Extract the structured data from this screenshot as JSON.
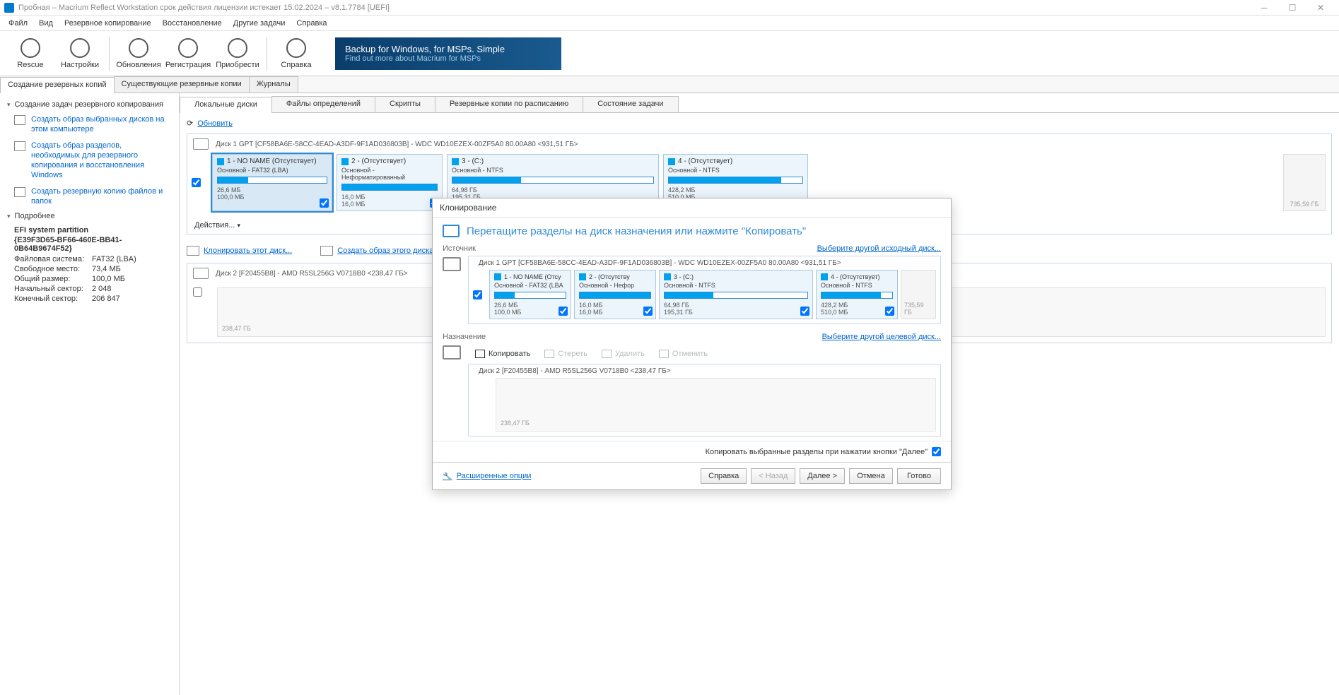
{
  "titlebar": {
    "title": "Пробная – Macrium Reflect Workstation срок действия лицензии истекает 15.02.2024 – v8.1.7784  [UEFI]"
  },
  "menu": [
    "Файл",
    "Вид",
    "Резервное копирование",
    "Восстановление",
    "Другие задачи",
    "Справка"
  ],
  "toolbar": [
    {
      "label": "Rescue"
    },
    {
      "label": "Настройки"
    },
    {
      "label": "Обновления"
    },
    {
      "label": "Регистрация"
    },
    {
      "label": "Приобрести"
    },
    {
      "label": "Справка"
    }
  ],
  "banner": {
    "line1": "Backup for Windows, for MSPs. Simple",
    "line2": "Find out more about Macrium for MSPs"
  },
  "ptabs": [
    "Создание резервных копий",
    "Существующие резервные копии",
    "Журналы"
  ],
  "sidebar": {
    "create_head": "Создание задач резервного копирования",
    "items": [
      "Создать образ выбранных дисков на этом компьютере",
      "Создать образ разделов, необходимых для резервного копирования и восстановления Windows",
      "Создать резервную копию файлов и папок"
    ],
    "details_head": "Подробнее",
    "details": {
      "title1": "EFI system partition",
      "title2": "{E39F3D65-BF66-460E-BB41-0B64B9674F52}",
      "rows": [
        {
          "k": "Файловая система:",
          "v": "FAT32 (LBA)"
        },
        {
          "k": "Свободное место:",
          "v": "73,4 МБ"
        },
        {
          "k": "Общий размер:",
          "v": "100,0 МБ"
        },
        {
          "k": "Начальный сектор:",
          "v": "2 048"
        },
        {
          "k": "Конечный сектор:",
          "v": "206 847"
        }
      ]
    }
  },
  "subtabs": [
    "Локальные диски",
    "Файлы определений",
    "Скрипты",
    "Резервные копии по расписанию",
    "Состояние задачи"
  ],
  "refresh": "Обновить",
  "disk1": {
    "header": "Диск 1 GPT [CF58BA6E-58CC-4EAD-A3DF-9F1AD036803B] - WDC WD10EZEX-00ZF5A0 80.00A80  <931,51 ГБ>",
    "parts": [
      {
        "name": "1 -  NO NAME (Отсутствует)",
        "type": "Основной - FAT32 (LBA)",
        "used": "26,6 МБ",
        "total": "100,0 МБ",
        "fill": 28
      },
      {
        "name": "2 -   (Отсутствует)",
        "type": "Основной - Неформатированный",
        "used": "16,0 МБ",
        "total": "16,0 МБ",
        "fill": 100
      },
      {
        "name": "3 -   (C:)",
        "type": "Основной - NTFS",
        "used": "64,98 ГБ",
        "total": "195,31 ГБ",
        "fill": 34
      },
      {
        "name": "4 -   (Отсутствует)",
        "type": "Основной - NTFS",
        "used": "428,2 МБ",
        "total": "510,0 МБ",
        "fill": 84
      }
    ],
    "unalloc": "735,59 ГБ",
    "actions": "Действия...",
    "widths": [
      170,
      150,
      300,
      205
    ]
  },
  "links": {
    "clone": "Клонировать этот диск...",
    "image": "Создать образ этого диска..."
  },
  "disk2": {
    "header": "Диск 2 [F20455B8] - AMD R5SL256G V0718B0  <238,47 ГБ>",
    "unalloc": "238,47 ГБ"
  },
  "clone": {
    "title": "Клонирование",
    "prompt": "Перетащите разделы на диск назначения или нажмите \"Копировать\"",
    "source_label": "Источник",
    "source_link": "Выберите другой исходный диск...",
    "disk1_header": "Диск 1 GPT [CF58BA6E-58CC-4EAD-A3DF-9F1AD036803B] - WDC WD10EZEX-00ZF5A0 80.00A80  <931,51 ГБ>",
    "parts": [
      {
        "name": "1 -  NO NAME (Отсу",
        "type": "Основной - FAT32 (LBA",
        "used": "26,6 МБ",
        "total": "100,0 МБ",
        "fill": 28
      },
      {
        "name": "2 -   (Отсутству",
        "type": "Основной - Нефор",
        "used": "16,0 МБ",
        "total": "16,0 МБ",
        "fill": 100
      },
      {
        "name": "3 -   (C:)",
        "type": "Основной - NTFS",
        "used": "64,98 ГБ",
        "total": "195,31 ГБ",
        "fill": 34
      },
      {
        "name": "4 -   (Отсутствует)",
        "type": "Основной - NTFS",
        "used": "428,2 МБ",
        "total": "510,0 МБ",
        "fill": 84
      }
    ],
    "unalloc": "735,59 ГБ",
    "dest_label": "Назначение",
    "dest_link": "Выберите другой целевой диск...",
    "dest_toolbar": {
      "copy": "Копировать",
      "erase": "Стереть",
      "delete": "Удалить",
      "undo": "Отменить"
    },
    "disk2_header": "Диск 2 [F20455B8] - AMD R5SL256G V0718B0  <238,47 ГБ>",
    "dest_unalloc": "238,47 ГБ",
    "copy_opt": "Копировать выбранные разделы при нажатии кнопки \"Далее\"",
    "advanced": "Расширенные опции",
    "buttons": {
      "help": "Справка",
      "back": "< Назад",
      "next": "Далее >",
      "cancel": "Отмена",
      "finish": "Готово"
    }
  }
}
